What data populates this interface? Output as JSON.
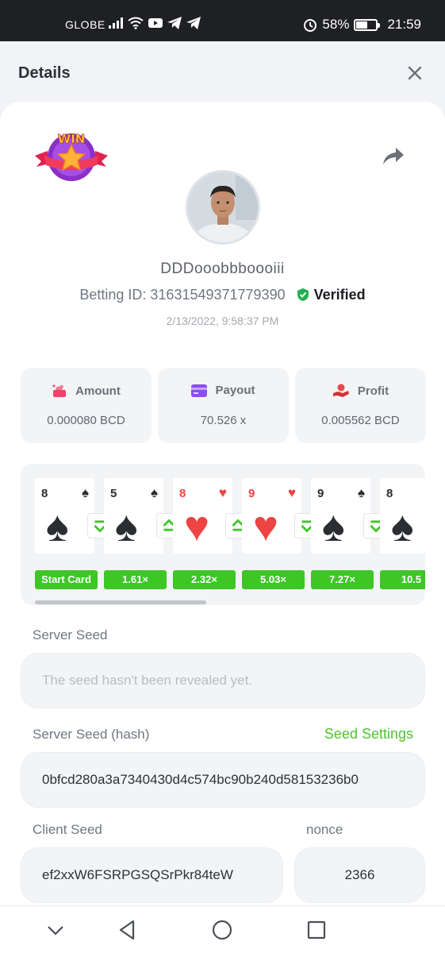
{
  "status_bar": {
    "carrier": "GLOBE",
    "battery": "58%",
    "battery_level": 0.58,
    "time": "21:59",
    "icons": [
      "signal-icon",
      "wifi-icon",
      "youtube-icon",
      "telegram-icon",
      "telegram-icon",
      "alarm-icon",
      "battery-icon"
    ]
  },
  "header": {
    "title": "Details",
    "close_icon": "close-icon"
  },
  "profile": {
    "username": "DDDooobbboooiii",
    "betting_id_label": "Betting ID:",
    "betting_id": "31631549371779390",
    "verified_label": "Verified",
    "date": "2/13/2022, 9:58:37 PM",
    "logo_text": "WIN"
  },
  "stats": [
    {
      "label": "Amount",
      "value": "0.000080 BCD",
      "icon": "amount-icon"
    },
    {
      "label": "Payout",
      "value": "70.526 x",
      "icon": "payout-icon"
    },
    {
      "label": "Profit",
      "value": "0.005562 BCD",
      "icon": "profit-icon"
    }
  ],
  "cards": [
    {
      "rank": "8",
      "suit": "♠",
      "color": "#2b2d33",
      "multiplier": "Start Card",
      "arrow": "down"
    },
    {
      "rank": "5",
      "suit": "♠",
      "color": "#2b2d33",
      "multiplier": "1.61×",
      "arrow": "up"
    },
    {
      "rank": "8",
      "suit": "♥",
      "color": "#ef4444",
      "multiplier": "2.32×",
      "arrow": "up"
    },
    {
      "rank": "9",
      "suit": "♥",
      "color": "#ef4444",
      "multiplier": "5.03×",
      "arrow": "down"
    },
    {
      "rank": "9",
      "suit": "♠",
      "color": "#2b2d33",
      "multiplier": "7.27×",
      "arrow": "down"
    },
    {
      "rank": "8",
      "suit": "♠",
      "color": "#2b2d33",
      "multiplier": "10.5",
      "arrow": ""
    }
  ],
  "seeds": {
    "server_seed_label": "Server Seed",
    "server_seed_placeholder": "The seed hasn't been revealed yet.",
    "server_seed_hash_label": "Server Seed (hash)",
    "seed_settings": "Seed Settings",
    "server_seed_hash": "0bfcd280a3a7340430d4c574bc90b240d58153236b0",
    "client_seed_label": "Client Seed",
    "client_seed": "ef2xxW6FSRPGSQSrPkr84teW",
    "nonce_label": "nonce",
    "nonce": "2366"
  },
  "colors": {
    "accent_green": "#3dc626",
    "verified_green": "#22b14c",
    "status_bar": "#1f2023"
  },
  "navbar": [
    "chevron-down-icon",
    "back-icon",
    "home-icon",
    "recents-icon"
  ]
}
